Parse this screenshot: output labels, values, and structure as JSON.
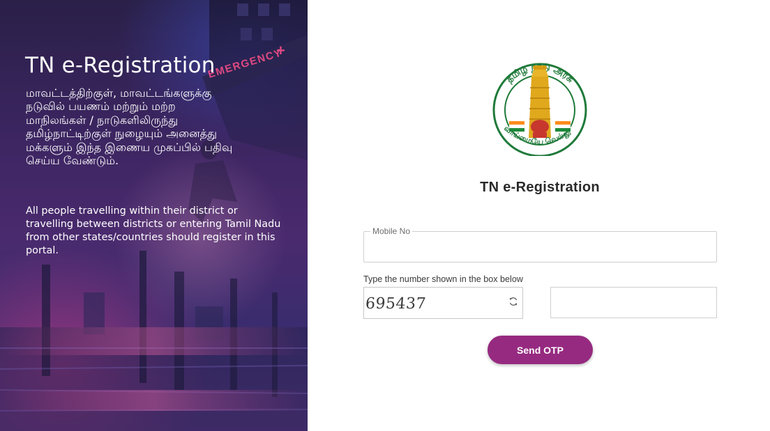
{
  "hero": {
    "title": "TN e-Registration",
    "tamil_text": "மாவட்டத்திற்குள், மாவட்டங்களுக்கு\nநடுவில் பயணம் மற்றும் மற்ற\nமாநிலங்கள் / நாடுகளிலிருந்து\nதமிழ்நாட்டிற்குள் நுழையும் அனைத்து\nமக்களும் இந்த இணைய முகப்பில் பதிவு\nசெய்ய வேண்டும்.",
    "english_text": "All people travelling within their district or travelling between districts or entering Tamil Nadu from other states/countries should register in this portal.",
    "background_sign": "EMERGENCY"
  },
  "emblem": {
    "top_text": "தமிழ் நாடு அரசு",
    "bottom_text": "வாய்மையே வெல்லும்"
  },
  "form": {
    "title": "TN e-Registration",
    "mobile_label": "Mobile No",
    "mobile_value": "",
    "captcha_hint": "Type the number shown in the box below",
    "captcha_code": "695437",
    "captcha_value": "",
    "send_otp_label": "Send OTP"
  },
  "colors": {
    "accent_button": "#962a80",
    "emblem_green": "#1f7a3a",
    "emblem_gold": "#e0a81c"
  },
  "icons": {
    "refresh": "refresh-icon"
  }
}
